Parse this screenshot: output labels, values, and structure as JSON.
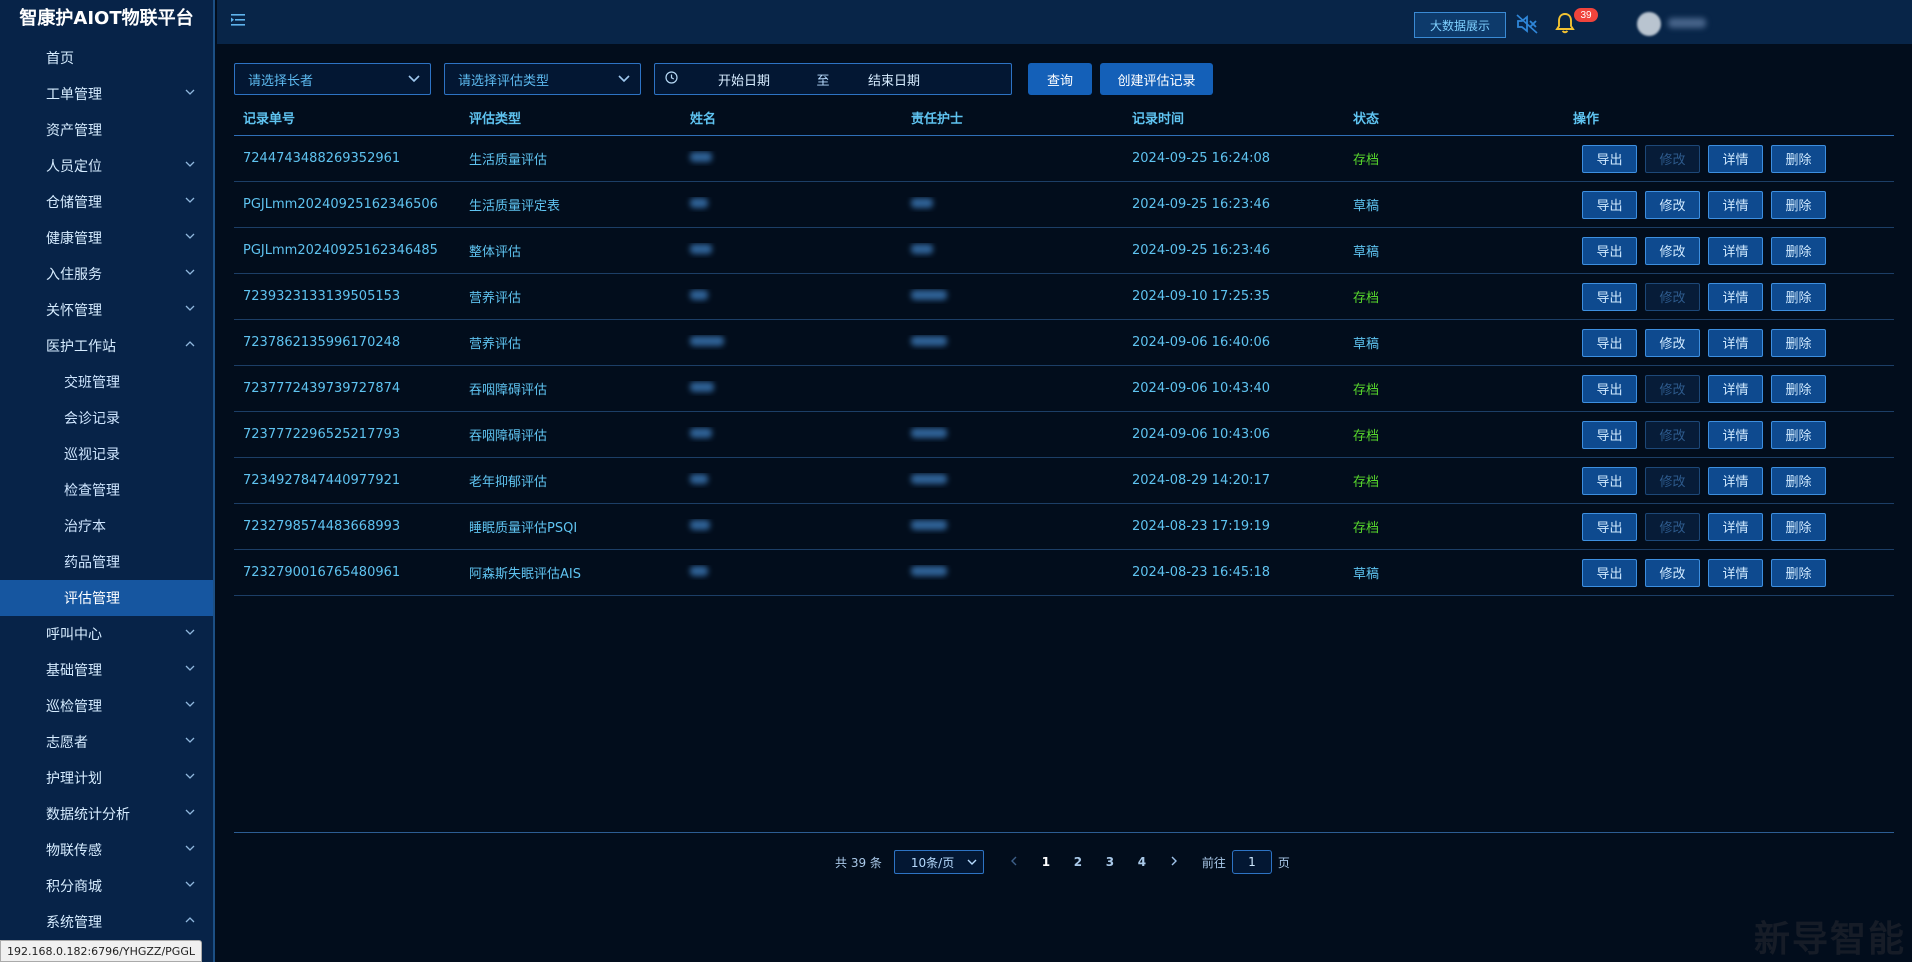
{
  "app": {
    "title": "智康护AIOT物联平台"
  },
  "sidebar": {
    "items": [
      {
        "label": "首页",
        "expandable": false
      },
      {
        "label": "工单管理",
        "expandable": true
      },
      {
        "label": "资产管理",
        "expandable": false
      },
      {
        "label": "人员定位",
        "expandable": true
      },
      {
        "label": "仓储管理",
        "expandable": true
      },
      {
        "label": "健康管理",
        "expandable": true
      },
      {
        "label": "入住服务",
        "expandable": true
      },
      {
        "label": "关怀管理",
        "expandable": true
      },
      {
        "label": "医护工作站",
        "expandable": true,
        "expanded": true
      },
      {
        "label": "交班管理",
        "sub": true
      },
      {
        "label": "会诊记录",
        "sub": true
      },
      {
        "label": "巡视记录",
        "sub": true
      },
      {
        "label": "检查管理",
        "sub": true
      },
      {
        "label": "治疗本",
        "sub": true
      },
      {
        "label": "药品管理",
        "sub": true
      },
      {
        "label": "评估管理",
        "sub": true,
        "active": true
      },
      {
        "label": "呼叫中心",
        "expandable": true
      },
      {
        "label": "基础管理",
        "expandable": true
      },
      {
        "label": "巡检管理",
        "expandable": true
      },
      {
        "label": "志愿者",
        "expandable": true
      },
      {
        "label": "护理计划",
        "expandable": true
      },
      {
        "label": "数据统计分析",
        "expandable": true
      },
      {
        "label": "物联传感",
        "expandable": true
      },
      {
        "label": "积分商城",
        "expandable": true
      },
      {
        "label": "系统管理",
        "expandable": true,
        "expanded": true
      }
    ],
    "status_url": "192.168.0.182:6796/YHGZZ/PGGL"
  },
  "header": {
    "bigdata_label": "大数据展示",
    "notification_count": "39"
  },
  "filters": {
    "elder_placeholder": "请选择长者",
    "type_placeholder": "请选择评估类型",
    "start_date_placeholder": "开始日期",
    "range_separator": "至",
    "end_date_placeholder": "结束日期",
    "query_label": "查询",
    "create_label": "创建评估记录"
  },
  "table": {
    "columns": [
      "记录单号",
      "评估类型",
      "姓名",
      "责任护士",
      "记录时间",
      "状态",
      "操作"
    ],
    "actions": {
      "export": "导出",
      "edit": "修改",
      "detail": "详情",
      "delete": "删除"
    },
    "rows": [
      {
        "id": "7244743488269352961",
        "type": "生活质量评估",
        "time": "2024-09-25 16:24:08",
        "status": "存档"
      },
      {
        "id": "PGJLmm20240925162346506",
        "type": "生活质量评定表",
        "time": "2024-09-25 16:23:46",
        "status": "草稿"
      },
      {
        "id": "PGJLmm20240925162346485",
        "type": "整体评估",
        "time": "2024-09-25 16:23:46",
        "status": "草稿"
      },
      {
        "id": "7239323133139505153",
        "type": "营养评估",
        "time": "2024-09-10 17:25:35",
        "status": "存档"
      },
      {
        "id": "7237862135996170248",
        "type": "营养评估",
        "time": "2024-09-06 16:40:06",
        "status": "草稿"
      },
      {
        "id": "7237772439739727874",
        "type": "吞咽障碍评估",
        "time": "2024-09-06 10:43:40",
        "status": "存档"
      },
      {
        "id": "7237772296525217793",
        "type": "吞咽障碍评估",
        "time": "2024-09-06 10:43:06",
        "status": "存档"
      },
      {
        "id": "7234927847440977921",
        "type": "老年抑郁评估",
        "time": "2024-08-29 14:20:17",
        "status": "存档"
      },
      {
        "id": "7232798574483668993",
        "type": "睡眠质量评估PSQI",
        "time": "2024-08-23 17:19:19",
        "status": "存档"
      },
      {
        "id": "7232790016765480961",
        "type": "阿森斯失眠评估AIS",
        "time": "2024-08-23 16:45:18",
        "status": "草稿"
      }
    ]
  },
  "pagination": {
    "total_label": "共 39 条",
    "page_size": "10条/页",
    "pages": [
      "1",
      "2",
      "3",
      "4"
    ],
    "current": "1",
    "goto_prefix": "前往",
    "goto_value": "1",
    "goto_suffix": "页"
  },
  "watermark": "新导智能"
}
